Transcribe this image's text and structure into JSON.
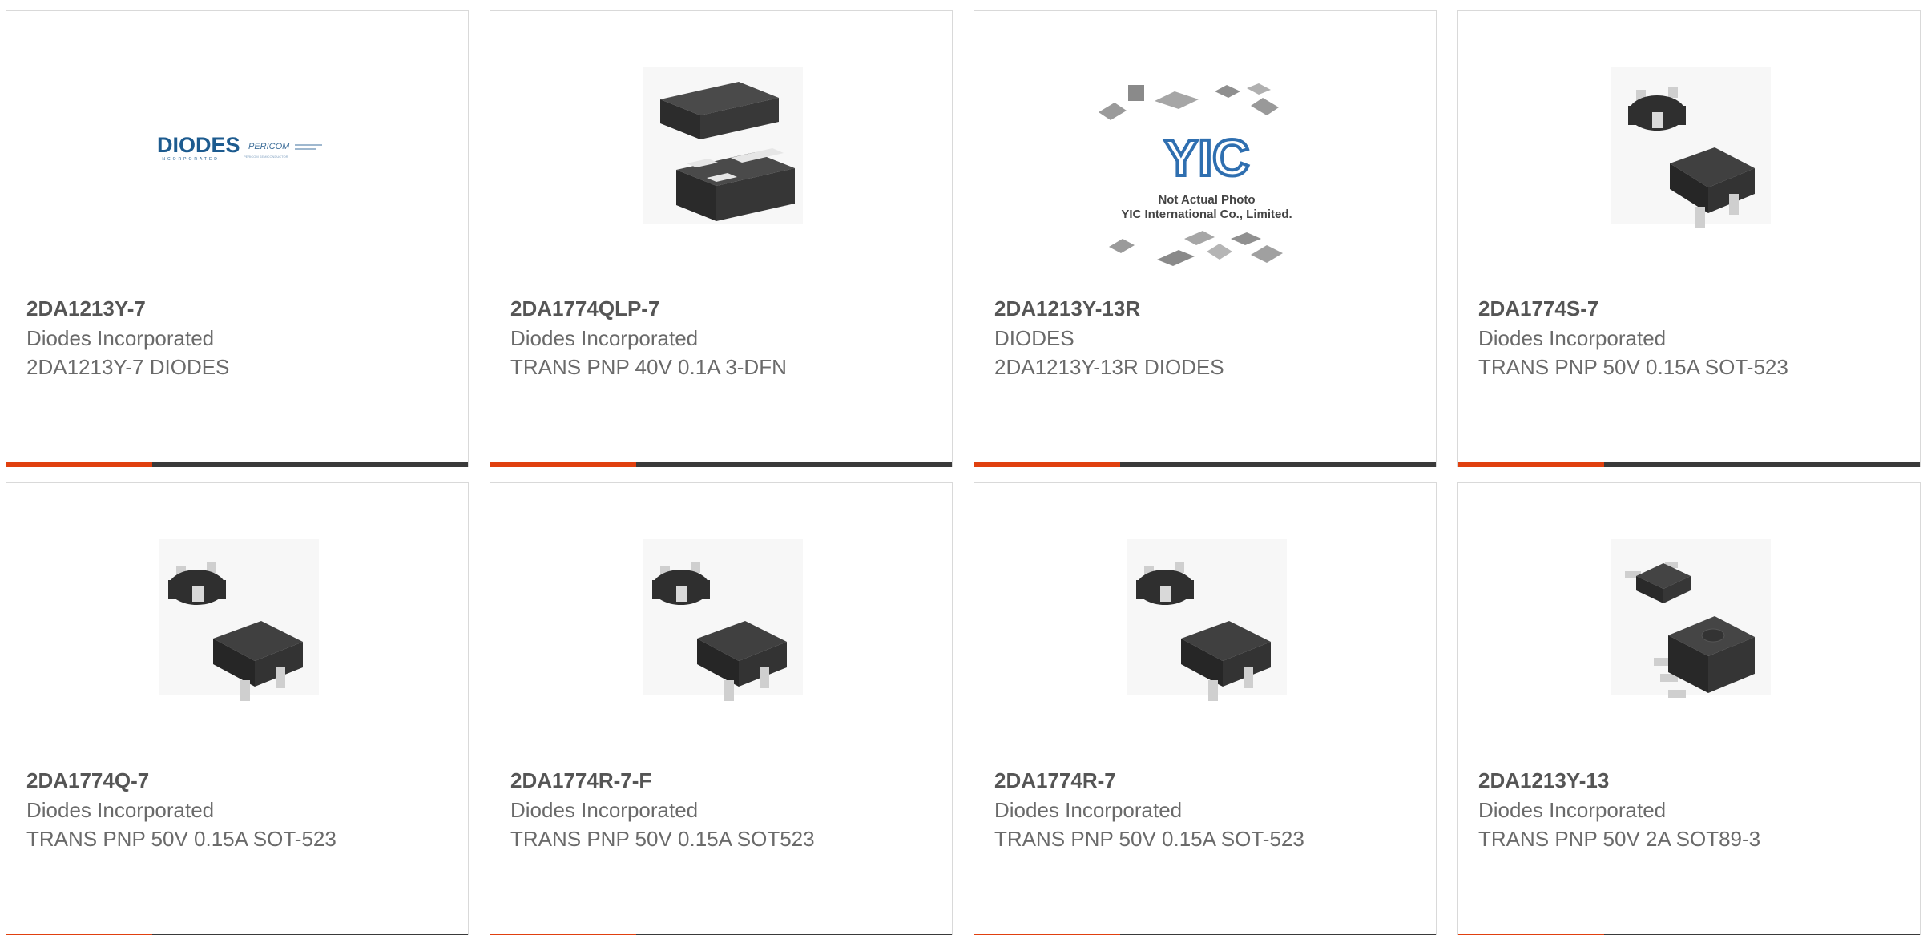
{
  "products": [
    {
      "part_number": "2DA1213Y-7",
      "manufacturer": "Diodes Incorporated",
      "description": "2DA1213Y-7 DIODES",
      "image_icon": "diodes-pericom-logo"
    },
    {
      "part_number": "2DA1774QLP-7",
      "manufacturer": "Diodes Incorporated",
      "description": "TRANS PNP 40V 0.1A 3-DFN",
      "image_icon": "dfn-package-icon"
    },
    {
      "part_number": "2DA1213Y-13R",
      "manufacturer": "DIODES",
      "description": "2DA1213Y-13R DIODES",
      "image_icon": "yic-placeholder-photo",
      "image_caption_1": "Not Actual Photo",
      "image_caption_2": "YIC International Co., Limited."
    },
    {
      "part_number": "2DA1774S-7",
      "manufacturer": "Diodes Incorporated",
      "description": "TRANS PNP 50V 0.15A SOT-523",
      "image_icon": "sot523-package-icon"
    },
    {
      "part_number": "2DA1774Q-7",
      "manufacturer": "Diodes Incorporated",
      "description": "TRANS PNP 50V 0.15A SOT-523",
      "image_icon": "sot523-package-icon"
    },
    {
      "part_number": "2DA1774R-7-F",
      "manufacturer": "Diodes Incorporated",
      "description": "TRANS PNP 50V 0.15A SOT523",
      "image_icon": "sot523-package-icon"
    },
    {
      "part_number": "2DA1774R-7",
      "manufacturer": "Diodes Incorporated",
      "description": "TRANS PNP 50V 0.15A SOT-523",
      "image_icon": "sot523-package-icon"
    },
    {
      "part_number": "2DA1213Y-13",
      "manufacturer": "Diodes Incorporated",
      "description": "TRANS PNP 50V 2A SOT89-3",
      "image_icon": "sot89-package-icon"
    }
  ],
  "logo": {
    "brand": "DIODES",
    "brand_sub": "INCORPORATED",
    "partner": "PERICOM",
    "partner_sub": "PERICOM SEMICONDUCTOR"
  },
  "yic_logo_text": "YIC",
  "colors": {
    "accent": "#e0400f",
    "bar": "#3a3a3a",
    "border": "#d9d9d9",
    "part_number": "#555555",
    "text": "#6a6a6a",
    "logo_blue": "#1d5b8f"
  }
}
